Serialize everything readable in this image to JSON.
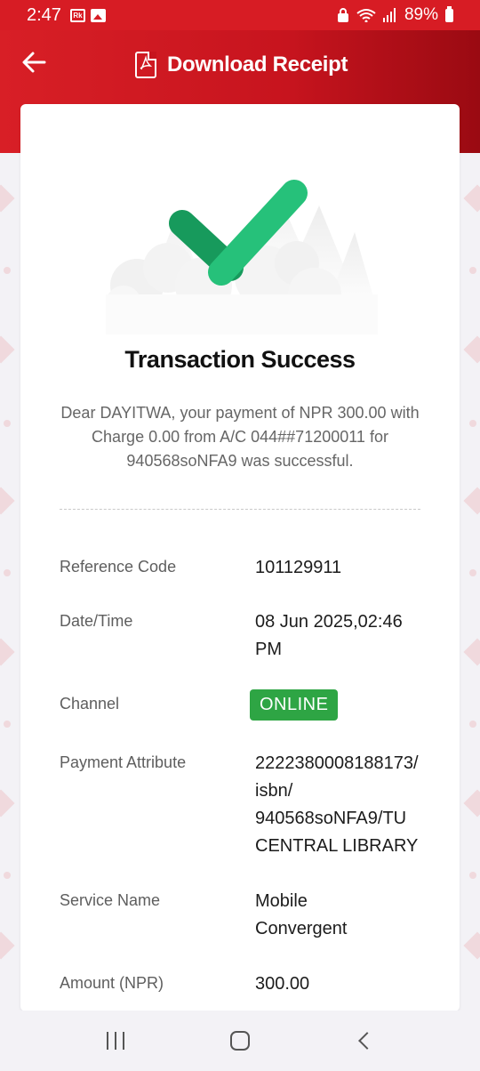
{
  "status_bar": {
    "time": "2:47",
    "battery": "89%",
    "icons": [
      "rk-app-icon",
      "gallery-icon",
      "lock-icon",
      "wifi-icon",
      "signal-icon",
      "battery-icon"
    ]
  },
  "header": {
    "title": "Download Receipt",
    "back_icon": "back-arrow-icon",
    "pdf_icon": "pdf-file-icon"
  },
  "receipt": {
    "title": "Transaction Success",
    "message": "Dear DAYITWA, your payment of NPR 300.00 with Charge 0.00 from A/C 044##71200011 for 940568soNFA9 was successful.",
    "rows": [
      {
        "label": "Reference Code",
        "value": "101129911"
      },
      {
        "label": "Date/Time",
        "value": "08 Jun 2025,02:46 PM"
      },
      {
        "label": "Channel",
        "value": "ONLINE"
      },
      {
        "label": "Payment Attribute",
        "value": "2222380008188173/ isbn/ 940568soNFA9/TU CENTRAL LIBRARY"
      },
      {
        "label": "Service Name",
        "value": "Mobile Convergent"
      },
      {
        "label": "Amount (NPR)",
        "value": "300.00"
      }
    ]
  },
  "colors": {
    "brand_red": "#d71c24",
    "success_green": "#2ea544",
    "check_green": "#26c17a"
  }
}
